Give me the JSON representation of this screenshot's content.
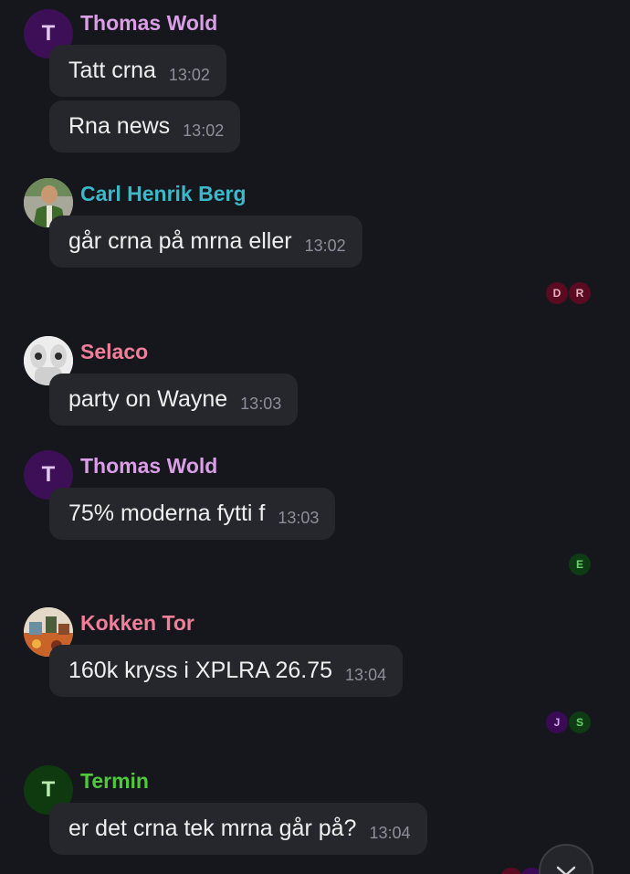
{
  "colors": {
    "background": "#15171c",
    "bubble": "#25272d",
    "message_text": "#eeeff1",
    "timestamp": "#8d9098"
  },
  "messages": [
    {
      "sender": "Thomas Wold",
      "sender_color": "#d99ee6",
      "avatar": {
        "type": "letter",
        "letter": "T",
        "bg": "#3d0f57",
        "fg": "#e2c6ee"
      },
      "lines": [
        {
          "text": "Tatt crna",
          "time": "13:02"
        },
        {
          "text": "Rna news",
          "time": "13:02"
        }
      ]
    },
    {
      "sender": "Carl Henrik Berg",
      "sender_color": "#3bb9c9",
      "avatar": {
        "type": "photo",
        "icon": "user-photo-icon"
      },
      "lines": [
        {
          "text": "går crna på mrna eller",
          "time": "13:02"
        }
      ]
    },
    {
      "sender": "Selaco",
      "sender_color": "#f07f9a",
      "avatar": {
        "type": "photo",
        "icon": "user-photo-icon"
      },
      "lines": [
        {
          "text": "party on Wayne",
          "time": "13:03"
        }
      ]
    },
    {
      "sender": "Thomas Wold",
      "sender_color": "#d99ee6",
      "avatar": {
        "type": "letter",
        "letter": "T",
        "bg": "#3d0f57",
        "fg": "#e2c6ee"
      },
      "lines": [
        {
          "text": "75% moderna fytti f",
          "time": "13:03"
        }
      ]
    },
    {
      "sender": "Kokken Tor",
      "sender_color": "#f07f9a",
      "avatar": {
        "type": "photo",
        "icon": "user-photo-icon"
      },
      "lines": [
        {
          "text": "160k kryss i XPLRA 26.75",
          "time": "13:04"
        }
      ]
    },
    {
      "sender": "Termin",
      "sender_color": "#4fc83c",
      "avatar": {
        "type": "letter",
        "letter": "T",
        "bg": "#0f3a0f",
        "fg": "#b9e8b0"
      },
      "lines": [
        {
          "text": "er det crna tek mrna går på?",
          "time": "13:04"
        }
      ]
    }
  ],
  "read_receipts": [
    {
      "letters": [
        "D",
        "R"
      ],
      "bg": "#5a0b22",
      "fg": "#e6b3c0"
    },
    {
      "letters": [
        "E"
      ],
      "bg": "#0e3a14",
      "fg": "#69d36d"
    },
    {
      "letters": [
        "J",
        "S"
      ],
      "bgs": [
        "#3a0a55",
        "#0e3a14"
      ],
      "fgs": [
        "#d3a8ee",
        "#69d36d"
      ]
    }
  ],
  "scroll_button": {
    "icon": "chevron-down-icon"
  }
}
